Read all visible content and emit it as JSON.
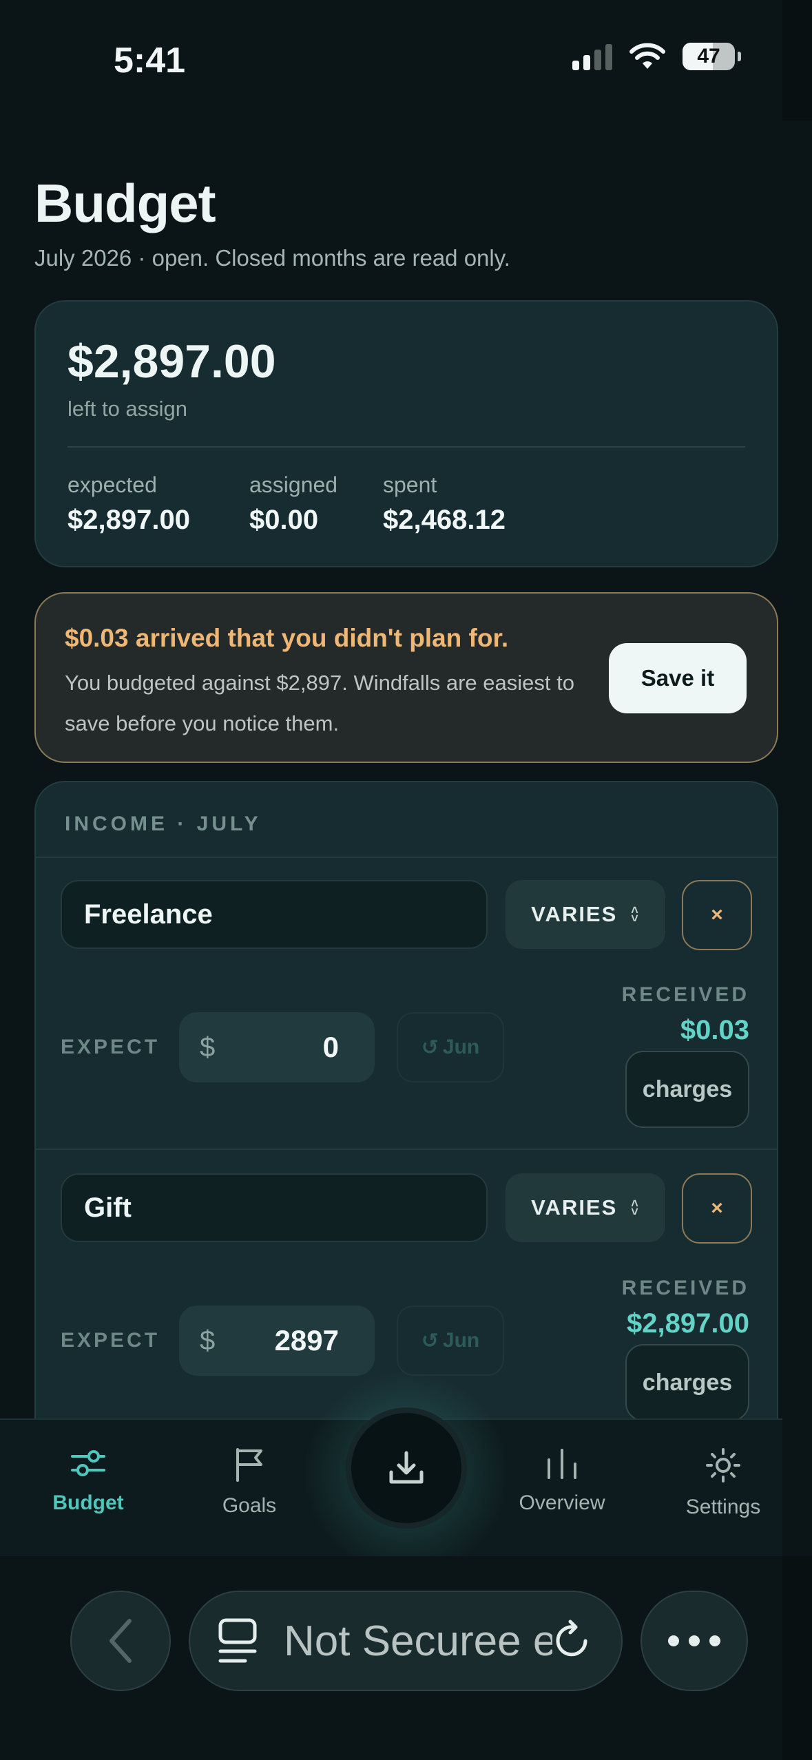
{
  "status_bar": {
    "time": "5:41",
    "battery": "47"
  },
  "header": {
    "title": "Budget",
    "subtitle": "July 2026 · open. Closed months are read only."
  },
  "summary": {
    "amount": "$2,897.00",
    "amount_label": "left to assign",
    "stats": [
      {
        "label": "expected",
        "value": "$2,897.00"
      },
      {
        "label": "assigned",
        "value": "$0.00"
      },
      {
        "label": "spent",
        "value": "$2,468.12"
      }
    ]
  },
  "alert": {
    "title": "$0.03 arrived that you didn't plan for.",
    "body": "You budgeted against $2,897. Windfalls are easiest to save before you notice them.",
    "button": "Save it"
  },
  "income": {
    "header": "INCOME · JULY",
    "items": [
      {
        "name": "Freelance",
        "type": "VARIES",
        "remove": "×",
        "expect_label": "EXPECT",
        "currency": "$",
        "expect_value": "0",
        "prev_label": "Jun",
        "received_label": "RECEIVED",
        "received_value": "$0.03",
        "charges_label": "charges"
      },
      {
        "name": "Gift",
        "type": "VARIES",
        "remove": "×",
        "expect_label": "EXPECT",
        "currency": "$",
        "expect_value": "2897",
        "prev_label": "Jun",
        "received_label": "RECEIVED",
        "received_value": "$2,897.00",
        "charges_label": "charges"
      }
    ]
  },
  "tabbar": {
    "tabs": [
      {
        "label": "Budget",
        "icon": "sliders-icon",
        "active": true
      },
      {
        "label": "Goals",
        "icon": "flag-icon",
        "active": false
      },
      {
        "label": "Overview",
        "icon": "bar-chart-icon",
        "active": false
      },
      {
        "label": "Settings",
        "icon": "gear-icon",
        "active": false
      }
    ],
    "fab_icon": "download-icon"
  },
  "browser": {
    "url_text": "Not Securee et"
  },
  "colors": {
    "accent": "#4fc7bd",
    "warning": "#efb776",
    "received": "#63d3c8",
    "background": "#0b1517"
  }
}
